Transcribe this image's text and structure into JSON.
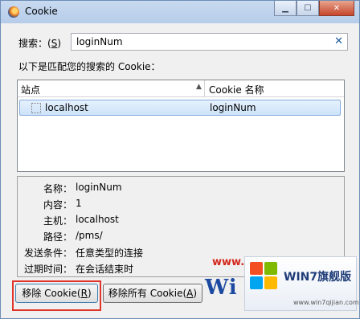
{
  "window": {
    "title": "Cookie"
  },
  "search": {
    "label": "搜索：",
    "mnemonic": "S",
    "label_open": "(",
    "label_close": ")",
    "value": "loginNum"
  },
  "list_caption": "以下是匹配您的搜索的 Cookie：",
  "table": {
    "headers": [
      "站点",
      "Cookie 名称"
    ],
    "rows": [
      {
        "site": "localhost",
        "name": "loginNum"
      }
    ]
  },
  "details": [
    {
      "label": "名称：",
      "value": "loginNum"
    },
    {
      "label": "内容：",
      "value": "1"
    },
    {
      "label": "主机：",
      "value": "localhost"
    },
    {
      "label": "路径：",
      "value": "/pms/"
    },
    {
      "label": "发送条件：",
      "value": "任意类型的连接"
    },
    {
      "label": "过期时间：",
      "value": "在会话结束时"
    }
  ],
  "buttons": {
    "remove": {
      "text": "移除 Cookie(",
      "mnemonic": "R",
      "close": ")"
    },
    "remove_all": {
      "text": "移除所有 Cookie(",
      "mnemonic": "A",
      "close": ")"
    }
  },
  "watermark": {
    "url": "www.win7zhijia.cn",
    "logo_text": "Wi",
    "badge_title": "WIN7旗舰版",
    "badge_url": "www.win7qijian.com"
  }
}
